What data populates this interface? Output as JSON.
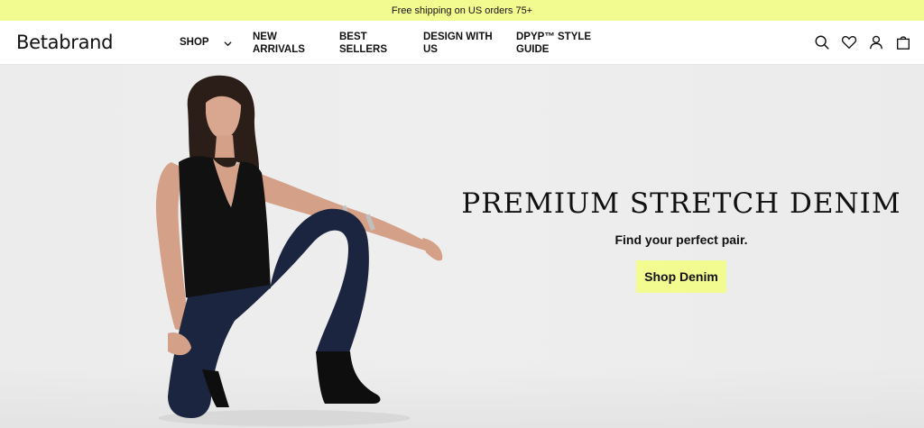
{
  "promo": {
    "text": "Free shipping on US orders 75+"
  },
  "brand": {
    "logo_text": "Betabrand"
  },
  "nav": {
    "items": [
      {
        "label": "SHOP"
      },
      {
        "label": "NEW ARRIVALS"
      },
      {
        "label": "BEST SELLERS"
      },
      {
        "label": "DESIGN WITH US"
      },
      {
        "label": "DPYP™ STYLE GUIDE"
      }
    ]
  },
  "header_icons": [
    "search-icon",
    "heart-icon",
    "account-icon",
    "cart-icon"
  ],
  "hero": {
    "title": "PREMIUM STRETCH DENIM",
    "subtitle": "Find your perfect pair.",
    "cta_label": "Shop Denim"
  },
  "colors": {
    "accent": "#f2fb8f",
    "hero_bg": "#ececec",
    "text": "#111111"
  }
}
